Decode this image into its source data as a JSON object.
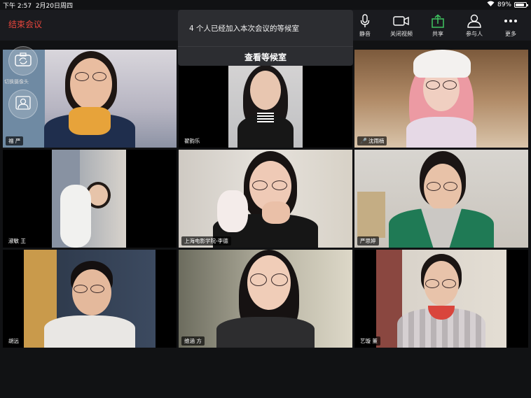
{
  "status_bar": {
    "time": "下午 2:57",
    "date": "2月20日周四",
    "battery": "89%",
    "battery_level": 0.89
  },
  "toolbar": {
    "end_meeting": "结束会议",
    "items": [
      {
        "label": "静音",
        "icon": "microphone-icon"
      },
      {
        "label": "关闭视频",
        "icon": "video-camera-icon"
      },
      {
        "label": "共享",
        "icon": "share-icon"
      },
      {
        "label": "参与人",
        "icon": "participants-icon"
      },
      {
        "label": "更多",
        "icon": "more-icon"
      }
    ]
  },
  "waiting_room": {
    "message": "4 个人已经加入本次会议的等候室",
    "action": "查看等候室"
  },
  "float_buttons": {
    "switch_camera": "切换摄像头",
    "avatar": ""
  },
  "participants": [
    {
      "name": "福 严",
      "muted": false
    },
    {
      "name": "翟韵乐",
      "muted": false
    },
    {
      "name": "沈雨楠",
      "muted": true
    },
    {
      "name": "淑敏 王",
      "muted": false
    },
    {
      "name": "上海电影学院-李德",
      "muted": false
    },
    {
      "name": "严思婷",
      "muted": false
    },
    {
      "name": "胡远",
      "muted": false
    },
    {
      "name": "维涵 方",
      "muted": false
    },
    {
      "name": "艺璇 董",
      "muted": false
    }
  ]
}
